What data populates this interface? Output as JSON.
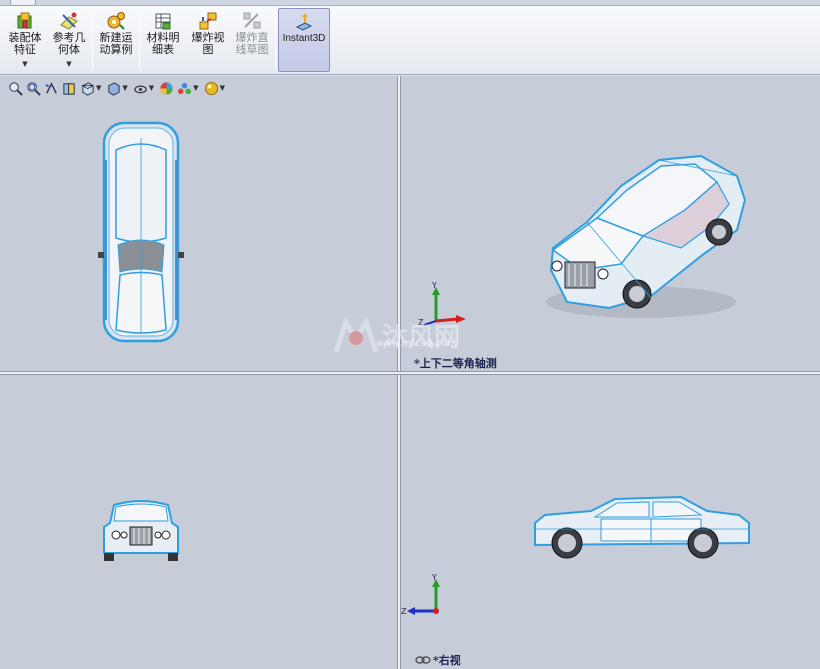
{
  "ribbon": {
    "buttons": [
      {
        "label": "装配体\n特征",
        "icon": "assembly-features-icon",
        "has_dropdown": true
      },
      {
        "label": "参考几\n何体",
        "icon": "reference-geometry-icon",
        "has_dropdown": true
      },
      {
        "label": "新建运\n动算例",
        "icon": "new-motion-study-icon"
      },
      {
        "label": "材料明\n细表",
        "icon": "bill-of-materials-icon"
      },
      {
        "label": "爆炸视\n图",
        "icon": "exploded-view-icon"
      },
      {
        "label": "爆炸直\n线草图",
        "icon": "explode-line-sketch-icon",
        "disabled": true
      },
      {
        "label": "Instant3D",
        "icon": "instant3d-icon",
        "active": true
      }
    ]
  },
  "view_toolbar": {
    "icons": [
      "zoom-to-fit-icon",
      "zoom-to-area-icon",
      "previous-view-icon",
      "section-view-icon",
      "view-orientation-icon",
      "display-style-icon",
      "hide-show-items-icon",
      "edit-appearance-icon",
      "apply-scene-icon",
      "view-settings-icon"
    ]
  },
  "viewports": {
    "top_right_label": "*上下二等角轴测",
    "bottom_right_label": "*右视",
    "triad_x": "X",
    "triad_y": "Y",
    "triad_z": "Z"
  },
  "watermark": {
    "text": "沐风网",
    "url": "www.mfcad.com"
  },
  "colors": {
    "wireframe": "#2f9fe0",
    "background": "#c6ccd8",
    "active_button": "#c4c9e6"
  }
}
